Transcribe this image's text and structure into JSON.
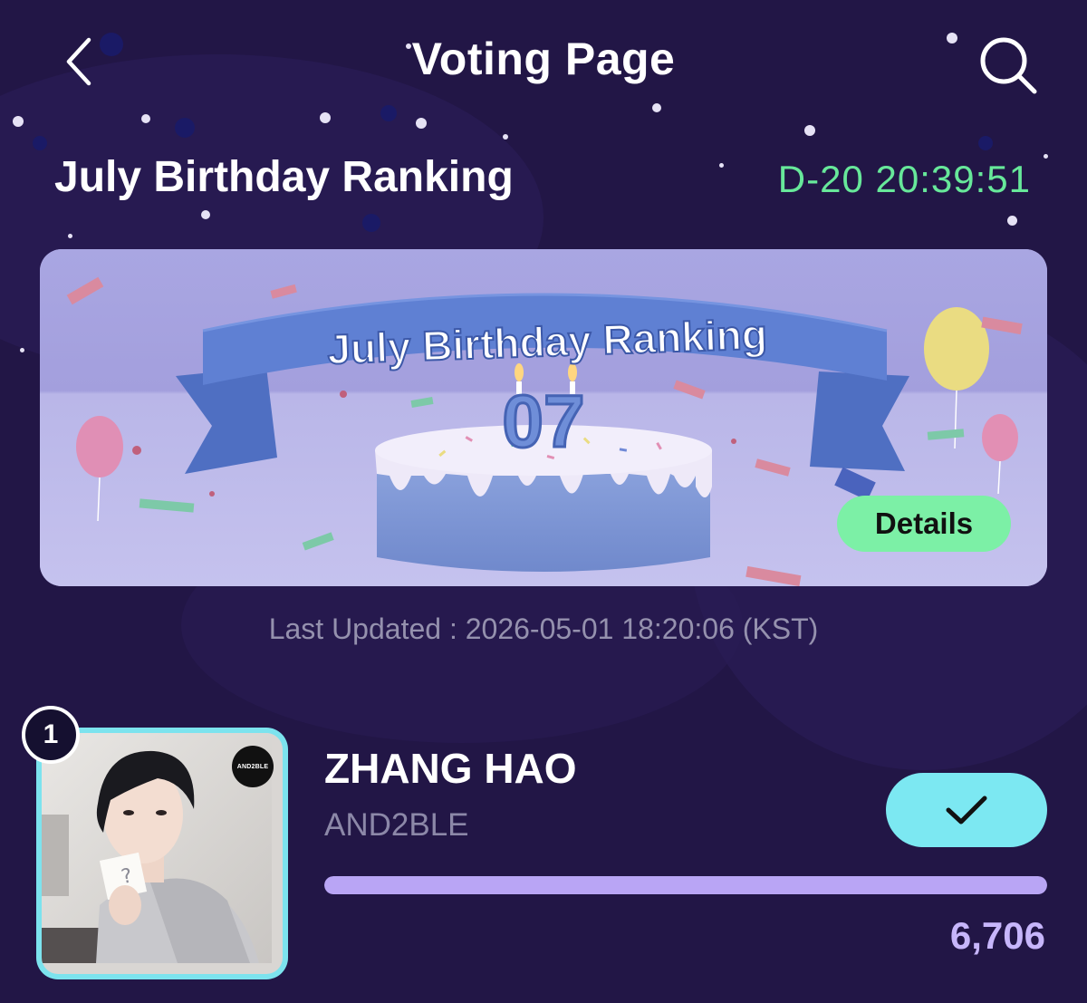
{
  "header": {
    "title": "Voting Page"
  },
  "section": {
    "title": "July Birthday Ranking",
    "countdown": "D-20 20:39:51"
  },
  "banner": {
    "headline": "July Birthday Ranking",
    "cake_number": "07",
    "details_label": "Details"
  },
  "last_updated": "Last Updated : 2026-05-01 18:20:06 (KST)",
  "ranking": [
    {
      "rank": "1",
      "name": "ZHANG HAO",
      "group": "AND2BLE",
      "group_logo_text": "AND2BLE",
      "votes": "6,706",
      "share": 1.0,
      "voted": true
    }
  ],
  "colors": {
    "background": "#221646",
    "countdown": "#67e89a",
    "details_button": "#7cf0a6",
    "vote_button": "#7ce8f2",
    "progress": "#b9a5f5",
    "vote_count": "#c7b6fb"
  },
  "icons": {
    "back": "chevron-left-icon",
    "search": "search-icon",
    "vote": "checkmark-icon"
  }
}
